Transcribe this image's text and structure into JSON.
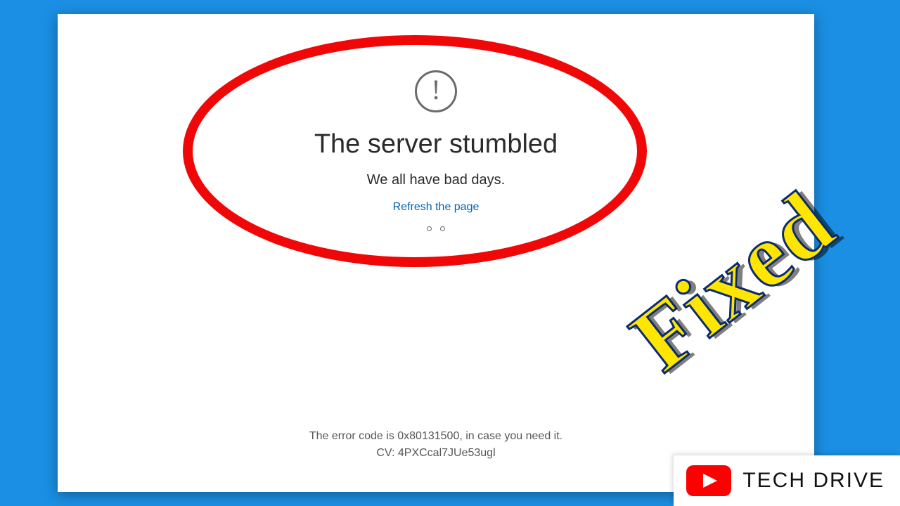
{
  "error": {
    "title": "The server stumbled",
    "subtitle": "We all have bad days.",
    "refresh_link": "Refresh the page",
    "error_code_line": "The error code is 0x80131500, in case you need it.",
    "cv_line": "CV: 4PXCcal7JUe53ugl"
  },
  "overlay": {
    "fixed_label": "Fixed"
  },
  "watermark": {
    "channel": "TECH DRIVE"
  }
}
